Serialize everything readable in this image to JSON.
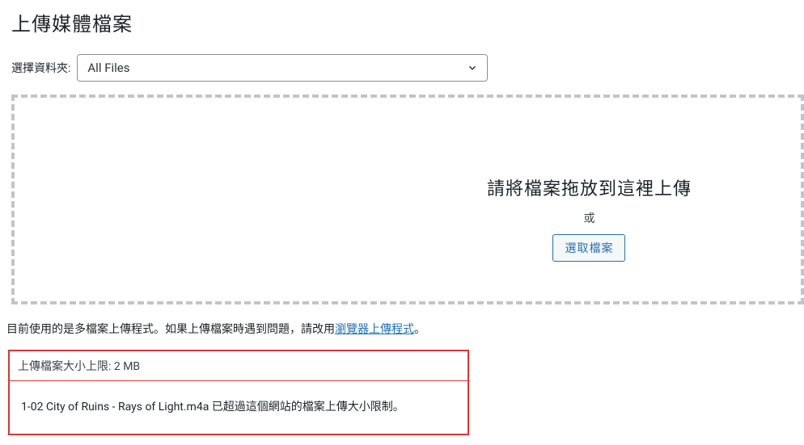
{
  "page": {
    "title": "上傳媒體檔案"
  },
  "folder": {
    "label": "選擇資料夾:",
    "selected": "All Files"
  },
  "dropzone": {
    "title": "請將檔案拖放到這裡上傳",
    "or": "或",
    "button": "選取檔案"
  },
  "uploader_note": {
    "prefix": "目前使用的是多檔案上傳程式。如果上傳檔案時遇到問題，請改用",
    "link": "瀏覽器上傳程式",
    "suffix": "。"
  },
  "limit": {
    "label": "上傳檔案大小上限: 2 MB"
  },
  "error": {
    "filename": "1-02 City of Ruins - Rays of Light.m4a",
    "message": " 已超過這個網站的檔案上傳大小限制。"
  }
}
